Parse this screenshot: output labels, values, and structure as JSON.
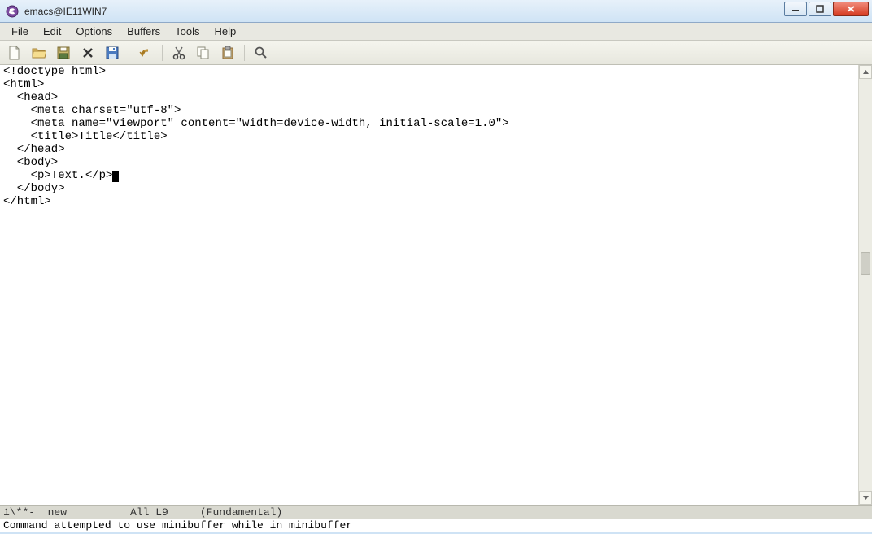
{
  "window": {
    "title": "emacs@IE11WIN7",
    "controls": {
      "minimize": "minimize-icon",
      "maximize": "maximize-icon",
      "close": "close-icon"
    }
  },
  "menu": {
    "items": [
      "File",
      "Edit",
      "Options",
      "Buffers",
      "Tools",
      "Help"
    ]
  },
  "toolbar": {
    "buttons": [
      {
        "name": "new-file-icon"
      },
      {
        "name": "open-folder-icon"
      },
      {
        "name": "save-as-dir-icon"
      },
      {
        "name": "close-x-icon"
      },
      {
        "name": "save-floppy-icon"
      },
      {
        "sep": true
      },
      {
        "name": "undo-icon"
      },
      {
        "sep": true
      },
      {
        "name": "cut-icon"
      },
      {
        "name": "copy-icon"
      },
      {
        "name": "paste-icon"
      },
      {
        "sep": true
      },
      {
        "name": "search-icon"
      }
    ]
  },
  "editor": {
    "lines": [
      "<!doctype html>",
      "<html>",
      "  <head>",
      "    <meta charset=\"utf-8\">",
      "    <meta name=\"viewport\" content=\"width=device-width, initial-scale=1.0\">",
      "    <title>Title</title>",
      "  </head>",
      "  <body>",
      "    <p>Text.</p>",
      "  </body>",
      "</html>"
    ],
    "cursor_line": 8
  },
  "modeline": {
    "left": "1\\**-  new",
    "position": "All L9",
    "mode": "(Fundamental)"
  },
  "minibuffer": {
    "message": "Command attempted to use minibuffer while in minibuffer"
  },
  "colors": {
    "titlebar_top": "#e7f1fa",
    "titlebar_bottom": "#cfe3f5",
    "close_red_top": "#f08a7a",
    "close_red_bottom": "#d63b21",
    "menubar_bg": "#e8e8e1",
    "toolbar_bg": "#f5f5ee",
    "modeline_bg": "#d9d9d0"
  }
}
